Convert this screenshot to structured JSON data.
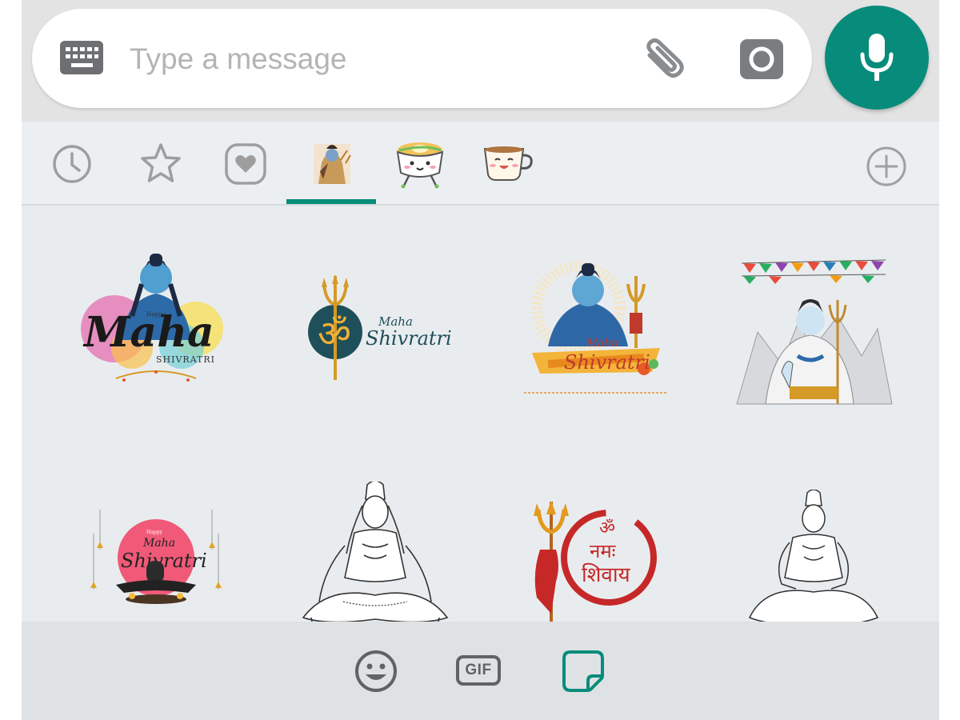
{
  "composer": {
    "placeholder": "Type a message",
    "keyboard_icon": "keyboard-icon",
    "attach_icon": "paperclip-icon",
    "camera_icon": "camera-icon",
    "mic_icon": "microphone-icon"
  },
  "colors": {
    "accent": "#078c7b",
    "icon_gray": "#9e9e9e",
    "background": "#e9ecef"
  },
  "tabs": [
    {
      "name": "recent",
      "icon": "clock-icon"
    },
    {
      "name": "favorites",
      "icon": "star-icon"
    },
    {
      "name": "heart-pack",
      "icon": "heart-icon"
    },
    {
      "name": "shiva-pack",
      "icon": "shiva-thumbnail",
      "selected": true
    },
    {
      "name": "food-bowl-pack",
      "icon": "bowl-sticker-thumbnail"
    },
    {
      "name": "coffee-cup-pack",
      "icon": "cup-sticker-thumbnail"
    }
  ],
  "add_pack_icon": "plus-circle-icon",
  "stickers": [
    {
      "id": "happy-maha-shivratri",
      "lines": [
        "Happy",
        "Maha",
        "SHIVRATRI"
      ]
    },
    {
      "id": "om-trishul-maha-shivratri",
      "lines": [
        "ॐ",
        "Maha",
        "Shivratri"
      ]
    },
    {
      "id": "shiva-maha-shivratri-banner",
      "lines": [
        "Maha",
        "Shivratri"
      ]
    },
    {
      "id": "shiva-trishul-mountains",
      "lines": []
    },
    {
      "id": "shivling-maha-shivratri",
      "lines": [
        "Happy",
        "Maha",
        "Shivratri"
      ]
    },
    {
      "id": "shiva-sketch-seated",
      "lines": []
    },
    {
      "id": "om-namah-shivaya",
      "lines": [
        "ॐ",
        "नमः",
        "शिवाय"
      ]
    },
    {
      "id": "shiva-sketch-meditating",
      "lines": []
    }
  ],
  "bottom_bar": {
    "emoji_icon": "emoji-icon",
    "gif_label": "GIF",
    "sticker_icon": "sticker-icon",
    "selected": "sticker"
  }
}
